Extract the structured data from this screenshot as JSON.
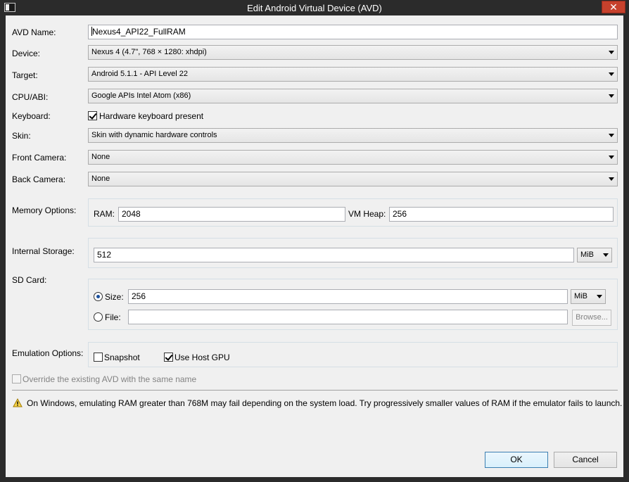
{
  "window": {
    "title": "Edit Android Virtual Device (AVD)",
    "close_glyph": "✕"
  },
  "form": {
    "avd_name_label": "AVD Name:",
    "avd_name_value": "Nexus4_API22_FullRAM",
    "device_label": "Device:",
    "device_value": "Nexus 4 (4.7\", 768 × 1280: xhdpi)",
    "target_label": "Target:",
    "target_value": "Android 5.1.1 - API Level 22",
    "cpu_label": "CPU/ABI:",
    "cpu_value": "Google APIs Intel Atom (x86)",
    "keyboard_label": "Keyboard:",
    "keyboard_check_label": "Hardware keyboard present",
    "keyboard_checked": true,
    "skin_label": "Skin:",
    "skin_value": "Skin with dynamic hardware controls",
    "front_camera_label": "Front Camera:",
    "front_camera_value": "None",
    "back_camera_label": "Back Camera:",
    "back_camera_value": "None",
    "memory_label": "Memory Options:",
    "ram_label": "RAM:",
    "ram_value": "2048",
    "vm_heap_label": "VM Heap:",
    "vm_heap_value": "256",
    "internal_storage_label": "Internal Storage:",
    "internal_storage_value": "512",
    "internal_storage_unit": "MiB",
    "sd_card_label": "SD Card:",
    "sd_size_label": "Size:",
    "sd_size_value": "256",
    "sd_size_unit": "MiB",
    "sd_size_selected": true,
    "sd_file_label": "File:",
    "sd_file_value": "",
    "browse_label": "Browse...",
    "emulation_label": "Emulation Options:",
    "snapshot_label": "Snapshot",
    "snapshot_checked": false,
    "host_gpu_label": "Use Host GPU",
    "host_gpu_checked": true,
    "override_label": "Override the existing AVD with the same name",
    "override_checked": false
  },
  "warning": {
    "icon": "warning-icon",
    "text": "On Windows, emulating RAM greater than 768M may fail depending on the system load. Try progressively smaller values of RAM if the emulator fails to launch."
  },
  "buttons": {
    "ok": "OK",
    "cancel": "Cancel"
  },
  "colors": {
    "titlebar": "#2b2b2b",
    "close": "#c7412c",
    "dialog_bg": "#f0f0f0",
    "default_button_border": "#3c7fb1"
  }
}
